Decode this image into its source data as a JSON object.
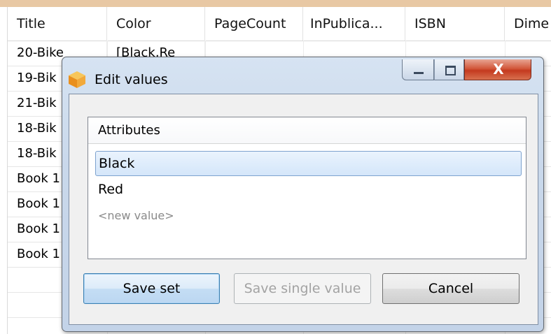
{
  "table": {
    "columns": [
      "Title",
      "Color",
      "PageCount",
      "InPublica...",
      "ISBN",
      "Dime"
    ],
    "rows": [
      [
        "20-Bike",
        "[Black,Re"
      ],
      [
        "19-Bik",
        ""
      ],
      [
        "21-Bik",
        ""
      ],
      [
        "18-Bik",
        ""
      ],
      [
        "18-Bik",
        ""
      ],
      [
        "Book 1",
        ""
      ],
      [
        "Book 1",
        ""
      ],
      [
        "Book 1",
        ""
      ],
      [
        "Book 1",
        ""
      ]
    ]
  },
  "dialog": {
    "title": "Edit values",
    "icon": "cube-app-icon",
    "window_buttons": {
      "close": "X"
    },
    "list": {
      "header": "Attributes",
      "items": [
        "Black",
        "Red"
      ],
      "new_value_placeholder": "<new value>",
      "selected_index": 0
    },
    "buttons": {
      "save_set": "Save set",
      "save_single": "Save single value",
      "cancel": "Cancel"
    }
  },
  "colors": {
    "accent": "#3c7fb1",
    "selection": "#d4e6fa",
    "close": "#c43a1f",
    "icon": "#f0a030"
  }
}
